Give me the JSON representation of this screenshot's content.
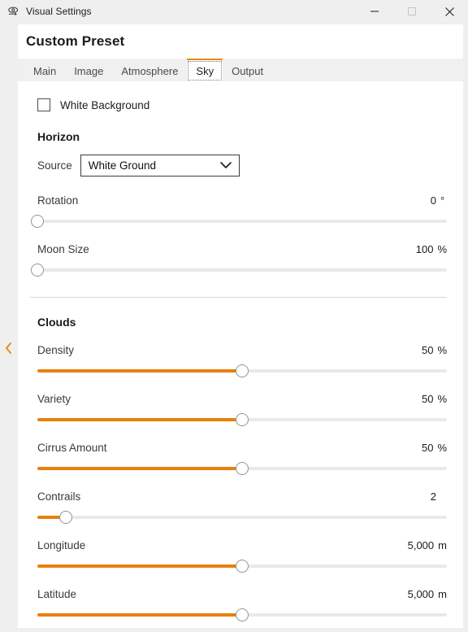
{
  "titlebar": {
    "icon": "visual-settings-eye-icon",
    "title": "Visual Settings",
    "minimize_label": "—",
    "maximize_label": "☐",
    "close_label": "✕"
  },
  "collapse": {
    "icon": "chevron-left-icon",
    "color": "#e8900f"
  },
  "preset": {
    "title": "Custom Preset"
  },
  "tabs": [
    {
      "label": "Main",
      "selected": false
    },
    {
      "label": "Image",
      "selected": false
    },
    {
      "label": "Atmosphere",
      "selected": false
    },
    {
      "label": "Sky",
      "selected": true
    },
    {
      "label": "Output",
      "selected": false
    }
  ],
  "white_background": {
    "label": "White Background",
    "checked": false
  },
  "horizon": {
    "title": "Horizon",
    "source": {
      "label": "Source",
      "value": "White Ground",
      "chevron_icon": "chevron-down-icon"
    },
    "sliders": [
      {
        "name": "rotation",
        "label": "Rotation",
        "value": "0",
        "unit": "°",
        "percent": 0
      },
      {
        "name": "moon-size",
        "label": "Moon Size",
        "value": "100",
        "unit": "%",
        "percent": 0
      }
    ]
  },
  "clouds": {
    "title": "Clouds",
    "sliders": [
      {
        "name": "density",
        "label": "Density",
        "value": "50",
        "unit": "%",
        "percent": 50
      },
      {
        "name": "variety",
        "label": "Variety",
        "value": "50",
        "unit": "%",
        "percent": 50
      },
      {
        "name": "cirrus-amount",
        "label": "Cirrus Amount",
        "value": "50",
        "unit": "%",
        "percent": 50
      },
      {
        "name": "contrails",
        "label": "Contrails",
        "value": "2",
        "unit": "",
        "percent": 7
      },
      {
        "name": "longitude",
        "label": "Longitude",
        "value": "5,000",
        "unit": "m",
        "percent": 50
      },
      {
        "name": "latitude",
        "label": "Latitude",
        "value": "5,000",
        "unit": "m",
        "percent": 50
      }
    ]
  },
  "theme": {
    "accent": "#e8800e",
    "track": "#e9e9e9",
    "titlebar_bg": "#efefef",
    "panel_bg": "#ffffff"
  }
}
